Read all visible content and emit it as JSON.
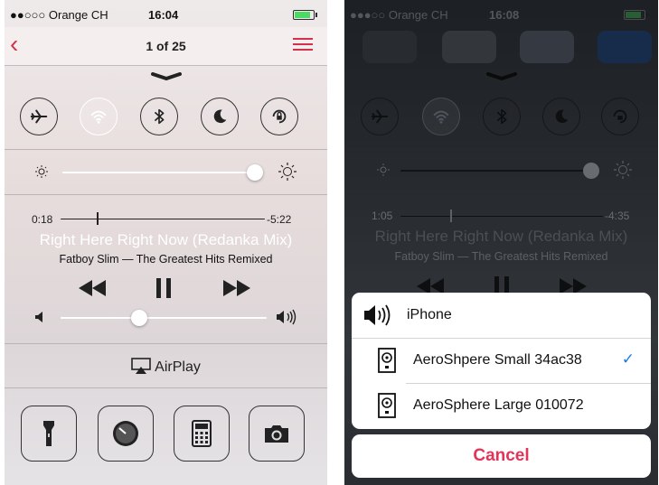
{
  "left": {
    "status": {
      "carrier": "●●○○○ Orange CH",
      "time": "16:04"
    },
    "nav": {
      "title": "1 of 25"
    },
    "media": {
      "elapsed": "0:18",
      "remaining": "-5:22",
      "song": "Right Here Right Now (Redanka Mix)",
      "artist_album": "Fatboy Slim — The Greatest Hits Remixed",
      "progress": 0.18,
      "volume": 0.38
    },
    "brightness": 0.96,
    "airplay_label": "AirPlay",
    "toggles": [
      "airplane-icon",
      "wifi-icon",
      "bluetooth-icon",
      "moon-icon",
      "rotation-lock-icon"
    ],
    "toggle_on": "wifi-icon",
    "quick_apps": [
      "flashlight-icon",
      "timer-icon",
      "calculator-icon",
      "camera-icon"
    ]
  },
  "right": {
    "status": {
      "carrier": "●●●○○ Orange CH",
      "time": "16:08"
    },
    "media": {
      "elapsed": "1:05",
      "remaining": "-4:35",
      "song": "Right Here Right Now (Redanka Mix)",
      "artist_album": "Fatboy Slim — The Greatest Hits Remixed",
      "progress": 0.25
    },
    "brightness": 0.96,
    "airplay_sheet": {
      "items": [
        {
          "label": "iPhone",
          "icon": "speaker-icon",
          "selected": false
        },
        {
          "label": "AeroShpere Small 34ac38",
          "icon": "speaker-box-icon",
          "selected": true
        },
        {
          "label": "AeroSphere Large 010072",
          "icon": "speaker-box-icon",
          "selected": false
        }
      ],
      "checkmark": "✓",
      "cancel": "Cancel"
    }
  },
  "colors": {
    "accent": "#d4304b",
    "check": "#1a7bf0",
    "cancel": "#e2345a"
  }
}
